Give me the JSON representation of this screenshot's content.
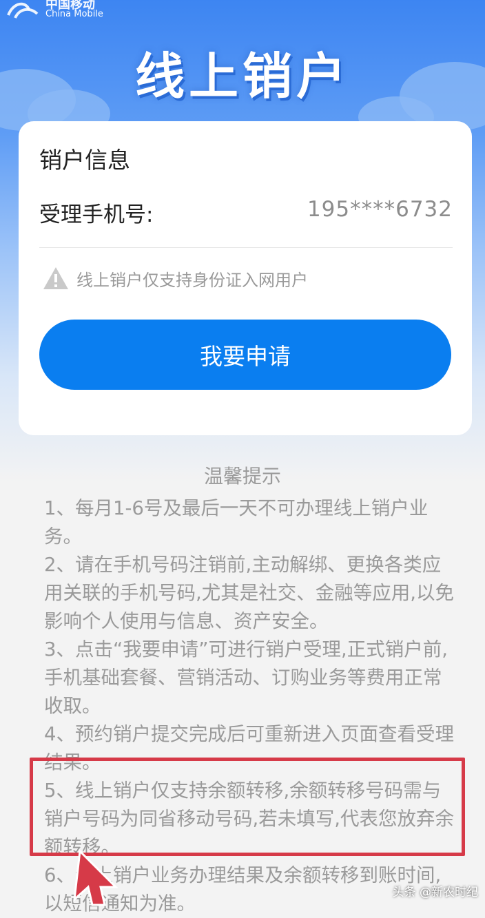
{
  "brand": {
    "name_cn": "中国移动",
    "name_en": "China Mobile"
  },
  "page_title": "线上销户",
  "card": {
    "title": "销户信息",
    "phone_label": "受理手机号:",
    "phone_value": "195****6732",
    "warning": "线上销户仅支持身份证入网用户",
    "apply_button": "我要申请"
  },
  "tips": {
    "title": "温馨提示",
    "items": [
      "1、每月1-6号及最后一天不可办理线上销户业务。",
      "2、请在手机号码注销前,主动解绑、更换各类应用关联的手机号码,尤其是社交、金融等应用,以免影响个人使用与信息、资产安全。",
      "3、点击“我要申请”可进行销户受理,正式销户前,手机基础套餐、营销活动、订购业务等费用正常收取。",
      "4、预约销户提交完成后可重新进入页面查看受理结果。",
      "5、线上销户仅支持余额转移,余额转移号码需与销户号码为同省移动号码,若未填写,代表您放弃余额转移。",
      "6、线上销户业务办理结果及余额转移到账时间,以短信通知为准。"
    ]
  },
  "watermark": "头条 @新农时纪",
  "colors": {
    "primary": "#0a7ef0",
    "highlight": "#d63a48",
    "header_blue": "#3d85f2"
  }
}
